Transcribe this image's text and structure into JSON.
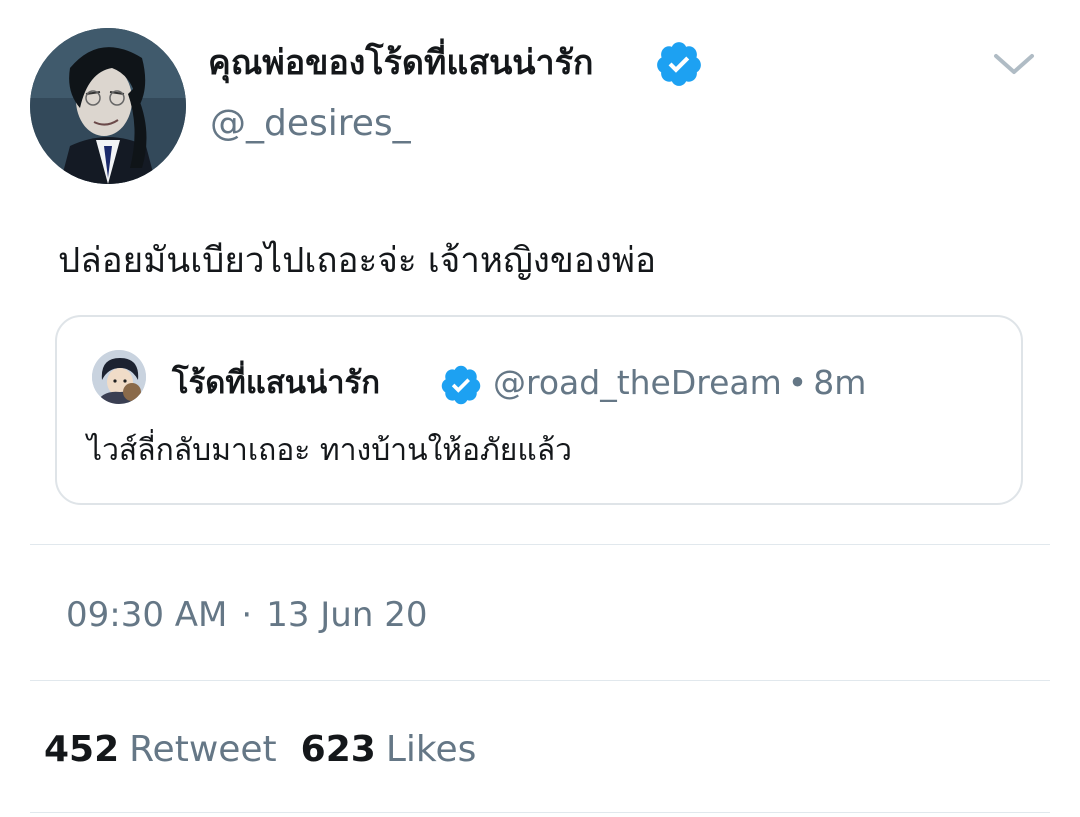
{
  "author": {
    "display_name": "คุณพ่อของโร้ดที่แสนน่ารัก",
    "handle": "@_desires_",
    "verified_icon": "verified-badge-icon"
  },
  "tweet": {
    "text": "ปล่อยมันเบียวไปเถอะจ่ะ เจ้าหญิงของพ่อ",
    "time": "09:30 AM",
    "separator": "·",
    "date": "13 Jun 20"
  },
  "quoted_tweet": {
    "display_name": "โร้ดที่แสนน่ารัก",
    "handle": "@road_theDream",
    "separator": "•",
    "age": "8m",
    "text": "ไวส์ลี่กลับมาเถอะ ทางบ้านให้อภัยแล้ว"
  },
  "stats": {
    "retweets_count": "452",
    "retweets_label": "Retweet",
    "likes_count": "623",
    "likes_label": "Likes"
  },
  "colors": {
    "text_primary": "#14171a",
    "text_secondary": "#657786",
    "verified_blue": "#1da1f2",
    "border": "#e1e8ed"
  }
}
